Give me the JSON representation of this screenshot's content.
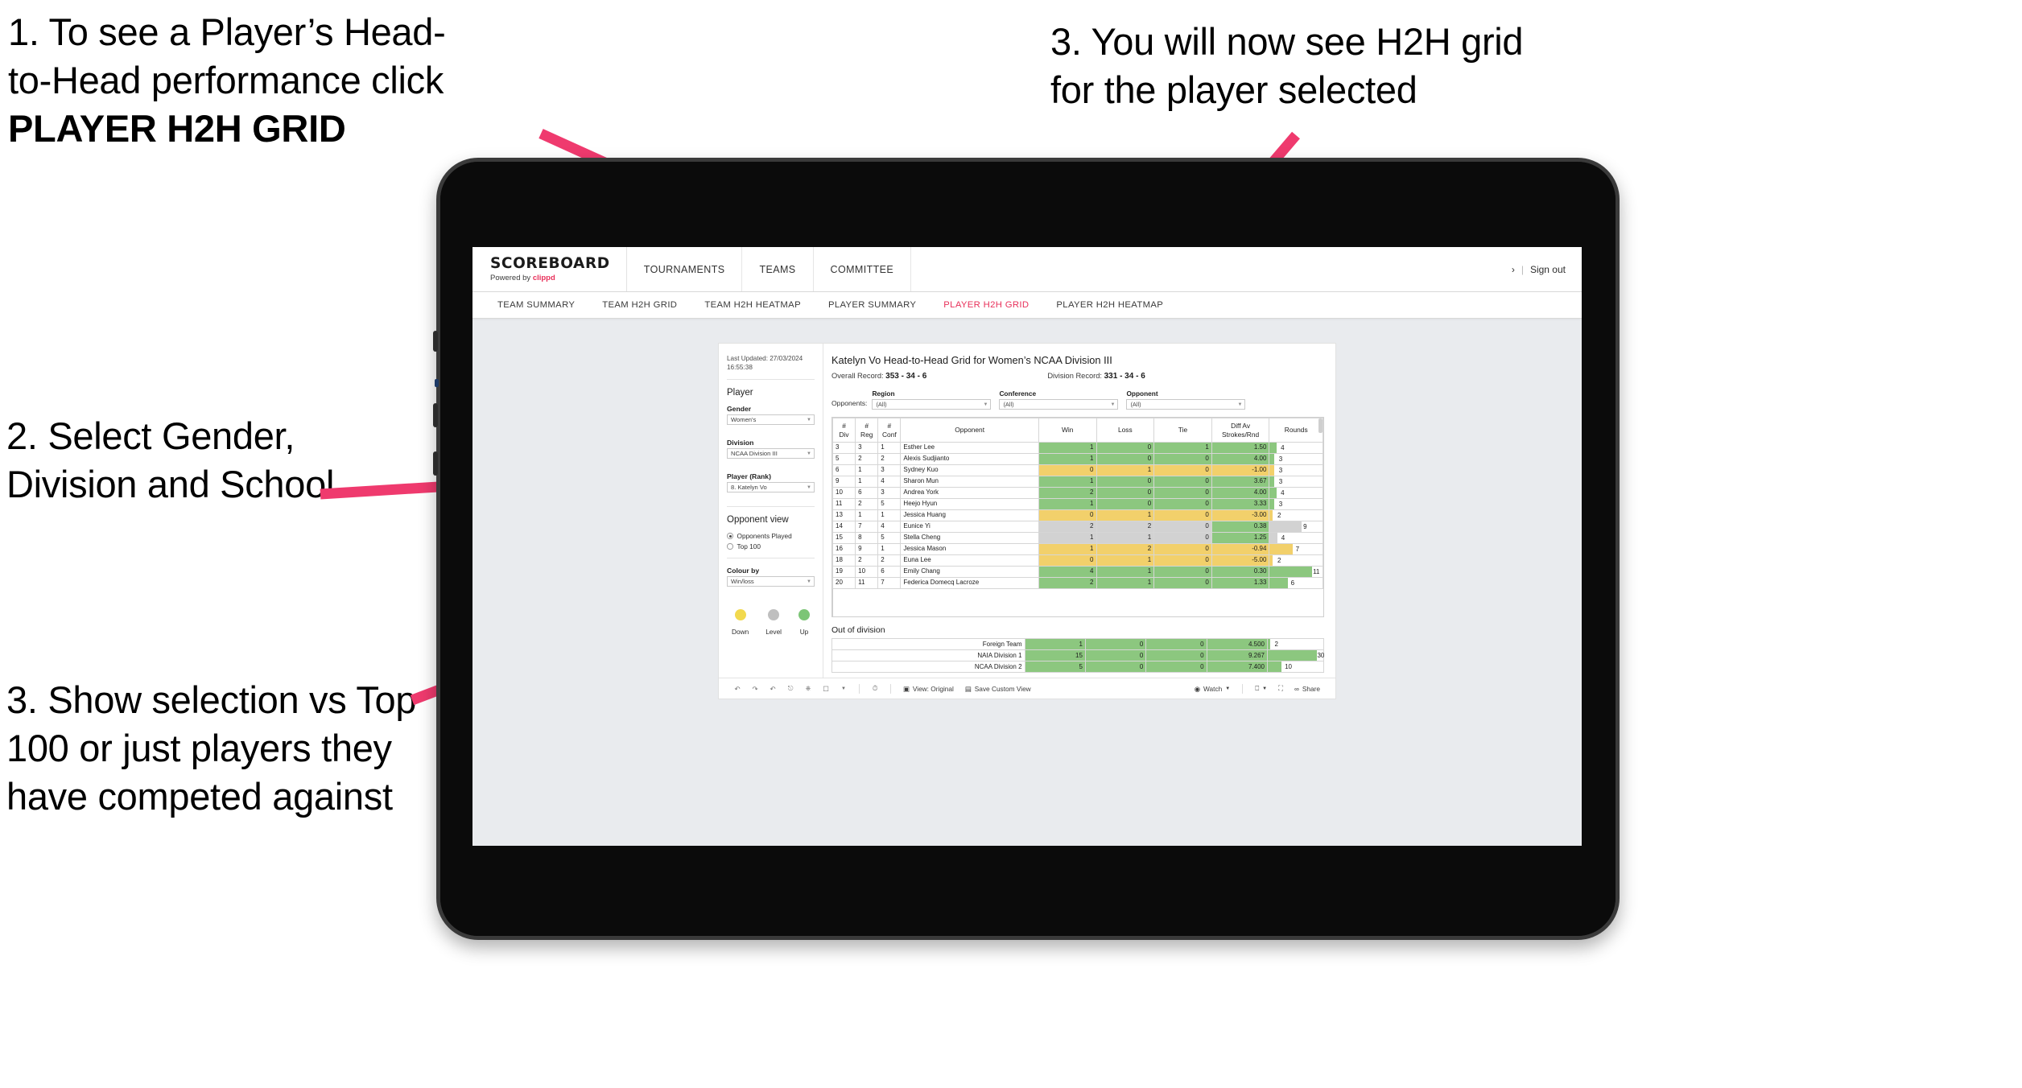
{
  "annotations": [
    {
      "id": "anno-1",
      "line1": "1. To see a Player’s Head-",
      "line2": "to-Head performance click",
      "line3": "PLAYER H2H GRID"
    },
    {
      "id": "anno-2",
      "line1": "3. You will now see H2H grid",
      "line2": "for the player selected"
    },
    {
      "id": "anno-3",
      "text": "2. Select Gender, Division and School"
    },
    {
      "id": "anno-4",
      "text": "3. Show selection vs Top 100 or just players they have competed against"
    }
  ],
  "appbar": {
    "brand_name": "SCOREBOARD",
    "brand_sub_prefix": "Powered by ",
    "brand_sub_clippd": "clippd",
    "nav": [
      "TOURNAMENTS",
      "TEAMS",
      "COMMITTEE"
    ],
    "sign_out": "Sign out",
    "separator": "|"
  },
  "subnav": {
    "tabs": [
      {
        "label": "TEAM SUMMARY",
        "active": false
      },
      {
        "label": "TEAM H2H GRID",
        "active": false
      },
      {
        "label": "TEAM H2H HEATMAP",
        "active": false
      },
      {
        "label": "PLAYER SUMMARY",
        "active": false
      },
      {
        "label": "PLAYER H2H GRID",
        "active": true
      },
      {
        "label": "PLAYER H2H HEATMAP",
        "active": false
      }
    ],
    "active_color": "#e8305a"
  },
  "sidebar": {
    "last_updated_line1": "Last Updated: 27/03/2024",
    "last_updated_line2": "16:55:38",
    "player_heading": "Player",
    "gender_label": "Gender",
    "gender_value": "Women's",
    "division_label": "Division",
    "division_value": "NCAA Division III",
    "player_rank_label": "Player (Rank)",
    "player_rank_value": "8. Katelyn Vo",
    "opponent_view_heading": "Opponent view",
    "opponent_options": [
      {
        "label": "Opponents Played",
        "selected": true
      },
      {
        "label": "Top 100",
        "selected": false
      }
    ],
    "colour_by_label": "Colour by",
    "colour_by_value": "Win/loss",
    "legend": [
      {
        "label": "Down",
        "color": "#f2d94e"
      },
      {
        "label": "Level",
        "color": "#bfbfbf"
      },
      {
        "label": "Up",
        "color": "#7cc576"
      }
    ]
  },
  "main": {
    "title": "Katelyn Vo Head-to-Head Grid for Women’s NCAA Division III",
    "overall_record_label": "Overall Record: ",
    "overall_record_value": "353 -  34 - 6",
    "division_record_label": "Division Record: ",
    "division_record_value": "331 -  34 - 6",
    "opponents_label": "Opponents:",
    "filters": [
      {
        "label": "Region",
        "value": "(All)"
      },
      {
        "label": "Conference",
        "value": "(All)"
      },
      {
        "label": "Opponent",
        "value": "(All)"
      }
    ],
    "out_of_division_title": "Out of division"
  },
  "chart_data": {
    "type": "table",
    "title": "Katelyn Vo Head-to-Head Grid for Women’s NCAA Division III",
    "columns": [
      "# Div",
      "# Reg",
      "# Conf",
      "Opponent",
      "Win",
      "Loss",
      "Tie",
      "Diff Av Strokes/Rnd",
      "Rounds"
    ],
    "column_headers_split": [
      {
        "l1": "#",
        "l2": "Div"
      },
      {
        "l1": "#",
        "l2": "Reg"
      },
      {
        "l1": "#",
        "l2": "Conf"
      },
      {
        "l1": "Opponent",
        "l2": ""
      },
      {
        "l1": "Win",
        "l2": ""
      },
      {
        "l1": "Loss",
        "l2": ""
      },
      {
        "l1": "Tie",
        "l2": ""
      },
      {
        "l1": "Diff Av",
        "l2": "Strokes/Rnd"
      },
      {
        "l1": "Rounds",
        "l2": ""
      }
    ],
    "colors": {
      "up": "#8cc77f",
      "down": "#f2d06b",
      "level": "#d2d2d2",
      "blank": "#ffffff"
    },
    "rows": [
      {
        "div": "3",
        "reg": "3",
        "conf": "1",
        "opponent": "Esther Lee",
        "win": "1",
        "loss": "0",
        "tie": "1",
        "diff": "1.50",
        "rounds": "4",
        "status": "up",
        "rounds_pct": 13
      },
      {
        "div": "5",
        "reg": "2",
        "conf": "2",
        "opponent": "Alexis Sudjianto",
        "win": "1",
        "loss": "0",
        "tie": "0",
        "diff": "4.00",
        "rounds": "3",
        "status": "up",
        "rounds_pct": 9
      },
      {
        "div": "6",
        "reg": "1",
        "conf": "3",
        "opponent": "Sydney Kuo",
        "win": "0",
        "loss": "1",
        "tie": "0",
        "diff": "-1.00",
        "rounds": "3",
        "status": "down",
        "rounds_pct": 9
      },
      {
        "div": "9",
        "reg": "1",
        "conf": "4",
        "opponent": "Sharon Mun",
        "win": "1",
        "loss": "0",
        "tie": "0",
        "diff": "3.67",
        "rounds": "3",
        "status": "up",
        "rounds_pct": 9
      },
      {
        "div": "10",
        "reg": "6",
        "conf": "3",
        "opponent": "Andrea York",
        "win": "2",
        "loss": "0",
        "tie": "0",
        "diff": "4.00",
        "rounds": "4",
        "status": "up",
        "rounds_pct": 13
      },
      {
        "div": "11",
        "reg": "2",
        "conf": "5",
        "opponent": "Heejo Hyun",
        "win": "1",
        "loss": "0",
        "tie": "0",
        "diff": "3.33",
        "rounds": "3",
        "status": "up",
        "rounds_pct": 9
      },
      {
        "div": "13",
        "reg": "1",
        "conf": "1",
        "opponent": "Jessica Huang",
        "win": "0",
        "loss": "1",
        "tie": "0",
        "diff": "-3.00",
        "rounds": "2",
        "status": "down",
        "rounds_pct": 6
      },
      {
        "div": "14",
        "reg": "7",
        "conf": "4",
        "opponent": "Eunice Yi",
        "win": "2",
        "loss": "2",
        "tie": "0",
        "diff": "0.38",
        "rounds": "9",
        "status": "level",
        "rounds_pct": 60,
        "diff_status": "up"
      },
      {
        "div": "15",
        "reg": "8",
        "conf": "5",
        "opponent": "Stella Cheng",
        "win": "1",
        "loss": "1",
        "tie": "0",
        "diff": "1.25",
        "rounds": "4",
        "status": "level",
        "rounds_pct": 14,
        "diff_status": "up"
      },
      {
        "div": "16",
        "reg": "9",
        "conf": "1",
        "opponent": "Jessica Mason",
        "win": "1",
        "loss": "2",
        "tie": "0",
        "diff": "-0.94",
        "rounds": "7",
        "status": "down",
        "rounds_pct": 44
      },
      {
        "div": "18",
        "reg": "2",
        "conf": "2",
        "opponent": "Euna Lee",
        "win": "0",
        "loss": "1",
        "tie": "0",
        "diff": "-5.00",
        "rounds": "2",
        "status": "down",
        "rounds_pct": 6
      },
      {
        "div": "19",
        "reg": "10",
        "conf": "6",
        "opponent": "Emily Chang",
        "win": "4",
        "loss": "1",
        "tie": "0",
        "diff": "0.30",
        "rounds": "11",
        "status": "up",
        "rounds_pct": 80
      },
      {
        "div": "20",
        "reg": "11",
        "conf": "7",
        "opponent": "Federica Domecq Lacroze",
        "win": "2",
        "loss": "1",
        "tie": "0",
        "diff": "1.33",
        "rounds": "6",
        "status": "up",
        "rounds_pct": 34
      }
    ],
    "out_of_division": {
      "title": "Out of division",
      "rows": [
        {
          "name": "Foreign Team",
          "win": "1",
          "loss": "0",
          "tie": "0",
          "diff": "4.500",
          "rounds": "2",
          "status": "up",
          "rounds_pct": 4
        },
        {
          "name": "NAIA Division 1",
          "win": "15",
          "loss": "0",
          "tie": "0",
          "diff": "9.267",
          "rounds": "30",
          "status": "up",
          "rounds_pct": 88
        },
        {
          "name": "NCAA Division 2",
          "win": "5",
          "loss": "0",
          "tie": "0",
          "diff": "7.400",
          "rounds": "10",
          "status": "up",
          "rounds_pct": 24
        }
      ]
    }
  },
  "toolbar": {
    "icons": [
      "undo-icon",
      "redo-icon",
      "revert-icon",
      "refresh-icon",
      "pause-icon",
      "share-view-icon",
      "caret-down-icon"
    ],
    "clock_icon": "clock-icon",
    "view_label": "View: Original",
    "save_label": "Save Custom View",
    "watch_label": "Watch",
    "download_icon": "download-icon",
    "fullscreen_icon": "fullscreen-icon",
    "share_label": "Share"
  }
}
